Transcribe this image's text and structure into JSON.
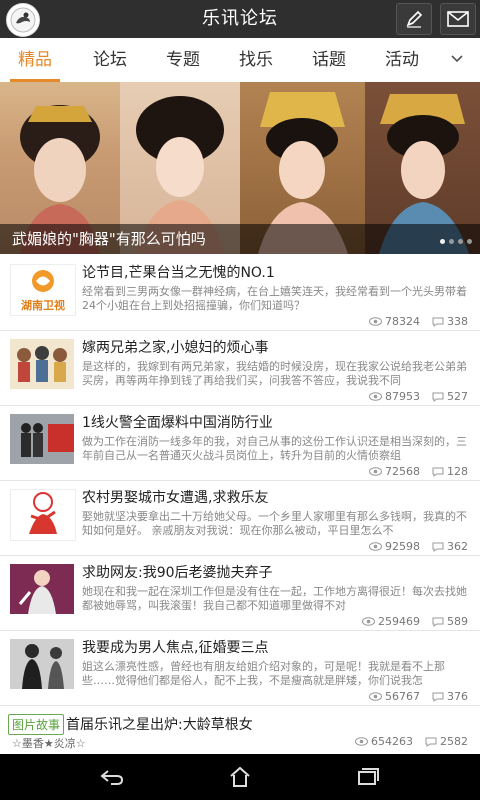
{
  "header": {
    "title": "乐讯论坛",
    "icons": [
      "avatar-icon",
      "edit-pen-icon",
      "mail-icon"
    ]
  },
  "tabs": [
    {
      "label": "精品",
      "active": true
    },
    {
      "label": "论坛",
      "active": false
    },
    {
      "label": "专题",
      "active": false
    },
    {
      "label": "找乐",
      "active": false
    },
    {
      "label": "话题",
      "active": false
    },
    {
      "label": "活动",
      "active": false
    }
  ],
  "banner": {
    "caption": "武媚娘的\"胸器\"有那么可怕吗",
    "page_count": 4,
    "active_page": 1
  },
  "posts": [
    {
      "title": "论节目,芒果台当之无愧的NO.1",
      "desc": "经常看到三男两女像一群神经病，在台上嬉笑连天，我经常看到一个光头男带着24个小姐在台上到处招摇撞骗，你们知道吗？",
      "views": "78324",
      "comments": "338",
      "thumb_text": "湖南卫视"
    },
    {
      "title": "嫁两兄弟之家,小媳妇的烦心事",
      "desc": "是这样的，我嫁到有两兄弟家，我结婚的时候没房，现在我家公说给我老公弟弟买房，再等两年挣到钱了再给我们买，问我答不答应，我说我不同",
      "views": "87953",
      "comments": "527"
    },
    {
      "title": "1线火警全面爆料中国消防行业",
      "desc": "做为工作在消防一线多年的我，对自己从事的这份工作认识还是相当深刻的，三年前自己从一名普通灭火战斗员岗位上，转升为目前的火情侦察组",
      "views": "72568",
      "comments": "128"
    },
    {
      "title": "农村男娶城市女遭遇,求救乐友",
      "desc": "娶她就坚决要拿出二十万给她父母。一个乡里人家哪里有那么多钱啊，我真的不知如何是好。 亲戚朋友对我说：现在你那么被动，平日里怎么不",
      "views": "92598",
      "comments": "362"
    },
    {
      "title": "求助网友:我90后老婆抛夫弃子",
      "desc": "她现在和我一起在深圳工作但是没有住在一起，工作地方离得很近！每次去找她都被她辱骂，叫我滚蛋！我自己都不知道哪里做得不对",
      "views": "259469",
      "comments": "589"
    },
    {
      "title": "我要成为男人焦点,征婚要三点",
      "desc": "姐这么漂亮性感，曾经也有朋友给姐介绍对象的，可是呢！我就是看不上那些……觉得他们都是俗人，配不上我，不是瘦高就是胖矮，你们说我怎",
      "views": "56767",
      "comments": "376"
    }
  ],
  "last_post": {
    "tag": "图片故事",
    "title": "首届乐讯之星出炉:大龄草根女",
    "author": "☆墨香★炎凉☆",
    "views": "654263",
    "comments": "2582"
  },
  "colors": {
    "accent": "#e6892b",
    "header_bg": "#2f2f2f",
    "tag_green": "#58a23c"
  }
}
